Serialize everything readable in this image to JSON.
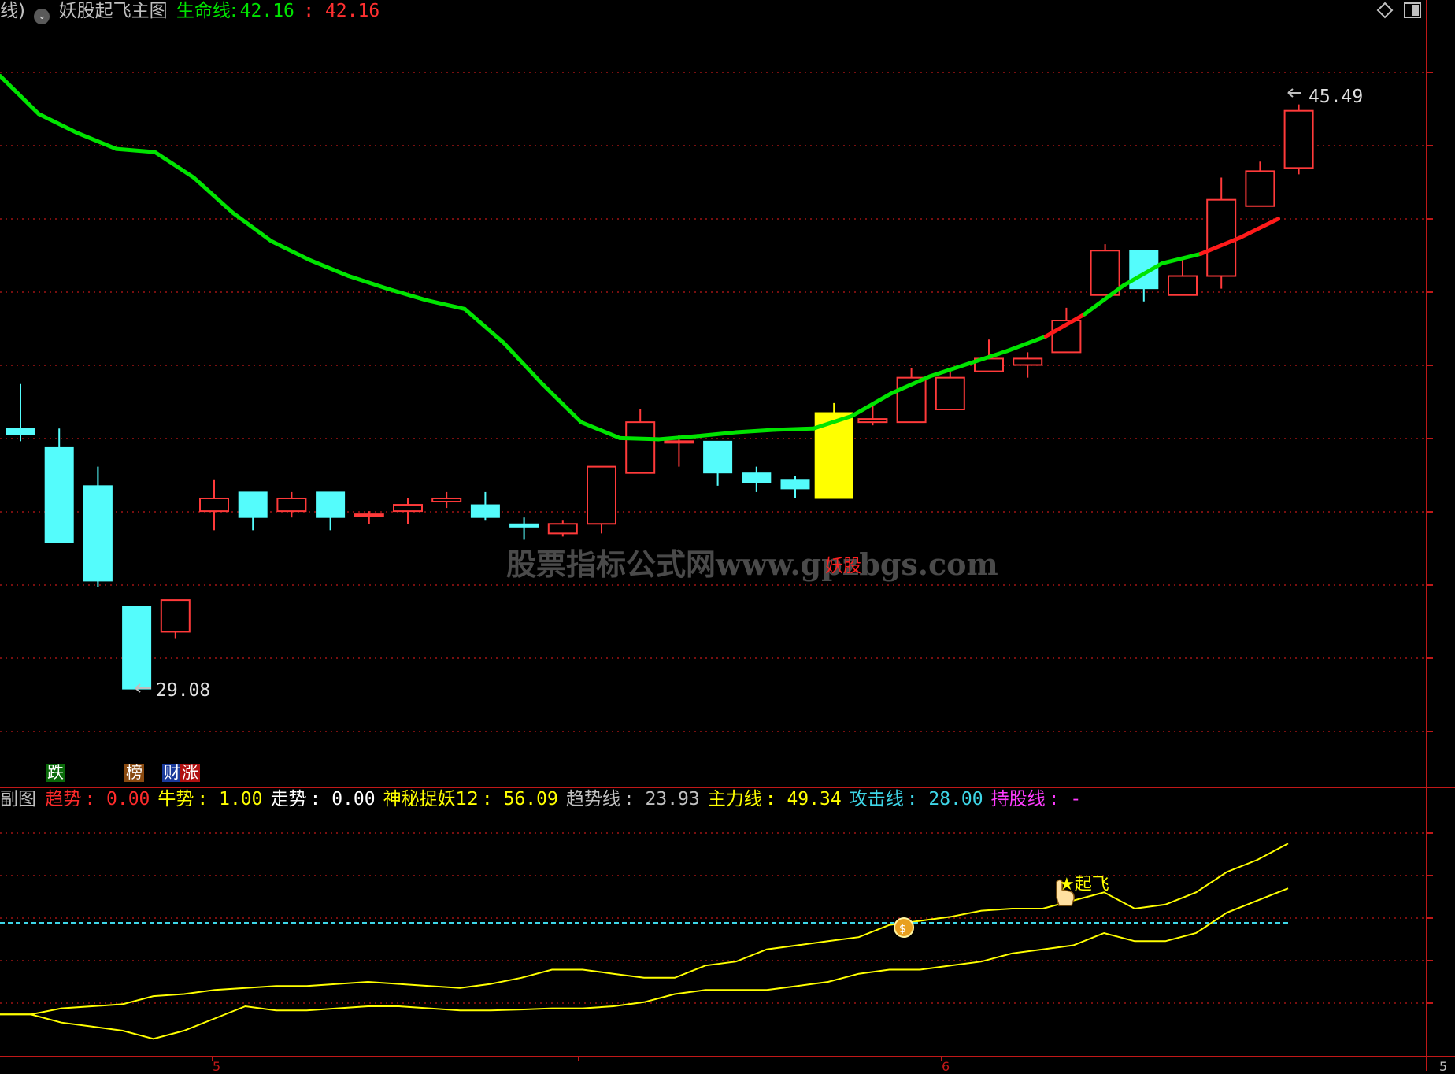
{
  "main_header": {
    "prefix": "线)",
    "indicator_name": "妖股起飞主图",
    "life_line_label": "生命线:",
    "life_line_value": "42.16",
    "life_line_value_2": ": 42.16"
  },
  "main_chart": {
    "high_label": "45.49",
    "low_label": "29.08",
    "signal_label": "妖股",
    "watermark": "股票指标公式网www.gpzbgs.com",
    "tags": {
      "die": "跌",
      "bang": "榜",
      "cai": "财",
      "zhang": "涨"
    },
    "colors": {
      "up": "#ff3a3a",
      "down": "#54fcfc",
      "signal": "#ffff00",
      "ma_green": "#00e400",
      "ma_red": "#ff1a1a"
    }
  },
  "sub_header": {
    "title": "副图",
    "items": [
      {
        "label": "趋势",
        "value": ": 0.00",
        "color": "#ff2b2b"
      },
      {
        "label": "牛势",
        "value": ": 1.00",
        "color": "#ffff00"
      },
      {
        "label": "走势",
        "value": ": 0.00",
        "color": "#ffffff"
      },
      {
        "label": "神秘捉妖12",
        "value": ": 56.09",
        "color": "#ffff00"
      },
      {
        "label": "趋势线",
        "value": ": 23.93",
        "color": "#c0c0c0"
      },
      {
        "label": "主力线",
        "value": ": 49.34",
        "color": "#ffff00"
      },
      {
        "label": "攻击线",
        "value": ": 28.00",
        "color": "#3ed6e8"
      },
      {
        "label": "持股线",
        "value": ": -",
        "color": "#ff3cff"
      }
    ]
  },
  "sub_chart": {
    "takeoff_label": "★起飞"
  },
  "x_axis": {
    "tick_1": "5",
    "tick_2": "6",
    "tick_3": "5"
  },
  "candles": [
    {
      "o": 32.6,
      "c": 32.5,
      "h": 33.3,
      "l": 32.4
    },
    {
      "o": 32.3,
      "c": 30.8,
      "h": 32.6,
      "l": 30.8
    },
    {
      "o": 31.7,
      "c": 30.2,
      "h": 32.0,
      "l": 30.1
    },
    {
      "o": 29.8,
      "c": 28.5,
      "h": 29.8,
      "l": 28.5
    },
    {
      "o": 29.4,
      "c": 29.9,
      "h": 29.9,
      "l": 29.3
    },
    {
      "o": 31.3,
      "c": 31.5,
      "h": 31.8,
      "l": 31.0
    },
    {
      "o": 31.6,
      "c": 31.2,
      "h": 31.6,
      "l": 31.0
    },
    {
      "o": 31.3,
      "c": 31.5,
      "h": 31.6,
      "l": 31.2
    },
    {
      "o": 31.6,
      "c": 31.2,
      "h": 31.6,
      "l": 31.0
    },
    {
      "o": 31.25,
      "c": 31.25,
      "h": 31.3,
      "l": 31.1
    },
    {
      "o": 31.3,
      "c": 31.4,
      "h": 31.5,
      "l": 31.1
    },
    {
      "o": 31.45,
      "c": 31.5,
      "h": 31.6,
      "l": 31.35
    },
    {
      "o": 31.4,
      "c": 31.2,
      "h": 31.6,
      "l": 31.15
    },
    {
      "o": 31.1,
      "c": 31.05,
      "h": 31.2,
      "l": 30.85
    },
    {
      "o": 30.95,
      "c": 31.1,
      "h": 31.15,
      "l": 30.9
    },
    {
      "o": 31.1,
      "c": 32.0,
      "h": 32.0,
      "l": 30.95
    },
    {
      "o": 31.9,
      "c": 32.7,
      "h": 32.9,
      "l": 31.9
    },
    {
      "o": 32.4,
      "c": 32.4,
      "h": 32.5,
      "l": 32.0
    },
    {
      "o": 32.4,
      "c": 31.9,
      "h": 32.4,
      "l": 31.7
    },
    {
      "o": 31.9,
      "c": 31.75,
      "h": 32.0,
      "l": 31.6
    },
    {
      "o": 31.8,
      "c": 31.65,
      "h": 31.85,
      "l": 31.5
    },
    {
      "o": 31.5,
      "c": 32.85,
      "h": 33.0,
      "l": 31.5
    },
    {
      "o": 32.7,
      "c": 32.75,
      "h": 33.0,
      "l": 32.65
    },
    {
      "o": 32.7,
      "c": 33.4,
      "h": 33.55,
      "l": 32.7
    },
    {
      "o": 32.9,
      "c": 33.4,
      "h": 33.5,
      "l": 32.9
    },
    {
      "o": 33.5,
      "c": 33.7,
      "h": 34.0,
      "l": 33.5
    },
    {
      "o": 33.6,
      "c": 33.7,
      "h": 33.8,
      "l": 33.4
    },
    {
      "o": 33.8,
      "c": 34.3,
      "h": 34.5,
      "l": 33.8
    },
    {
      "o": 34.7,
      "c": 35.4,
      "h": 35.5,
      "l": 34.7
    },
    {
      "o": 35.4,
      "c": 34.8,
      "h": 35.4,
      "l": 34.6
    },
    {
      "o": 34.7,
      "c": 35.0,
      "h": 35.3,
      "l": 34.7
    },
    {
      "o": 35.0,
      "c": 36.2,
      "h": 36.55,
      "l": 34.8
    },
    {
      "o": 36.1,
      "c": 36.65,
      "h": 36.8,
      "l": 36.1
    },
    {
      "o": 36.7,
      "c": 37.6,
      "h": 37.7,
      "l": 36.6
    }
  ],
  "ma_line": [
    38.15,
    37.55,
    37.25,
    37.0,
    36.95,
    36.55,
    36.0,
    35.55,
    35.25,
    35.0,
    34.8,
    34.62,
    34.48,
    33.95,
    33.3,
    32.7,
    32.45,
    32.43,
    32.48,
    32.54,
    32.58,
    32.6,
    32.8,
    33.15,
    33.42,
    33.62,
    33.82,
    34.05,
    34.4,
    34.85,
    35.2,
    35.35,
    35.6,
    35.9
  ],
  "ma_red_from": 27,
  "ma_red_to": 28,
  "ma_red_from_2": 31,
  "ma_red_to_2": 34,
  "sub_line_1": [
    30,
    30,
    31.5,
    32,
    32.5,
    34.5,
    35,
    36,
    36.5,
    37,
    37,
    37.5,
    38,
    37.5,
    37,
    36.5,
    37.5,
    39,
    41,
    41,
    40,
    39,
    39,
    42,
    43,
    46,
    47,
    48,
    49,
    52,
    53,
    54,
    55.5,
    56,
    56,
    58,
    60,
    56,
    57,
    60,
    65,
    68,
    72
  ],
  "sub_line_2": [
    30,
    30,
    28,
    27,
    26,
    24,
    26,
    29,
    32,
    31,
    31,
    31.5,
    32,
    32,
    31.5,
    31,
    31,
    31.2,
    31.5,
    31.5,
    32,
    33,
    35,
    36,
    36,
    36,
    37,
    38,
    40,
    41,
    41,
    42,
    43,
    45,
    46,
    47,
    50,
    48,
    48,
    50,
    55,
    58,
    61
  ]
}
